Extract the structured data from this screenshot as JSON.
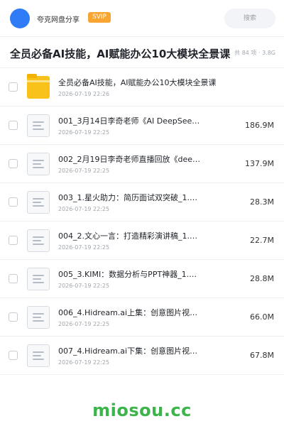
{
  "header": {
    "brand": "夸克网盘分享",
    "badge": "SVIP",
    "search_placeholder": "搜索",
    "avatar_color": "#2f7cf6"
  },
  "page": {
    "title": "全员必备AI技能，AI赋能办公10大模块全景课",
    "meta": "共 84 项 · 3.8G"
  },
  "files": [
    {
      "icon": "folder-icon",
      "name": "全员必备AI技能，AI赋能办公10大模块全景课",
      "date": "2026-07-19 22:26",
      "size": ""
    },
    {
      "icon": "file-icon",
      "name": "001_3月14日李奇老师《AI DeepSeee…",
      "date": "2026-07-19 22:25",
      "size": "186.9M"
    },
    {
      "icon": "file-icon",
      "name": "002_2月19日李奇老师直播回放《deepsee…",
      "date": "2026-07-19 22:25",
      "size": "137.9M"
    },
    {
      "icon": "file-icon",
      "name": "003_1.星火助力：简历面试双突破_1.mp4",
      "date": "2026-07-19 22:25",
      "size": "28.3M"
    },
    {
      "icon": "file-icon",
      "name": "004_2.文心一言：打造精彩演讲稿_1.mp4",
      "date": "2026-07-19 22:25",
      "size": "22.7M"
    },
    {
      "icon": "file-icon",
      "name": "005_3.KIMI：数据分析与PPT神器_1.m…",
      "date": "2026-07-19 22:25",
      "size": "28.8M"
    },
    {
      "icon": "file-icon",
      "name": "006_4.Hidream.ai上集：创意图片视频…",
      "date": "2026-07-19 22:25",
      "size": "66.0M"
    },
    {
      "icon": "file-icon",
      "name": "007_4.Hidream.ai下集：创意图片视频…",
      "date": "2026-07-19 22:25",
      "size": "67.8M"
    }
  ],
  "watermark": "miosou.cc",
  "colors": {
    "badge": "#f8a531",
    "folder": "#f9c21a",
    "watermark": "#3bb54a"
  }
}
